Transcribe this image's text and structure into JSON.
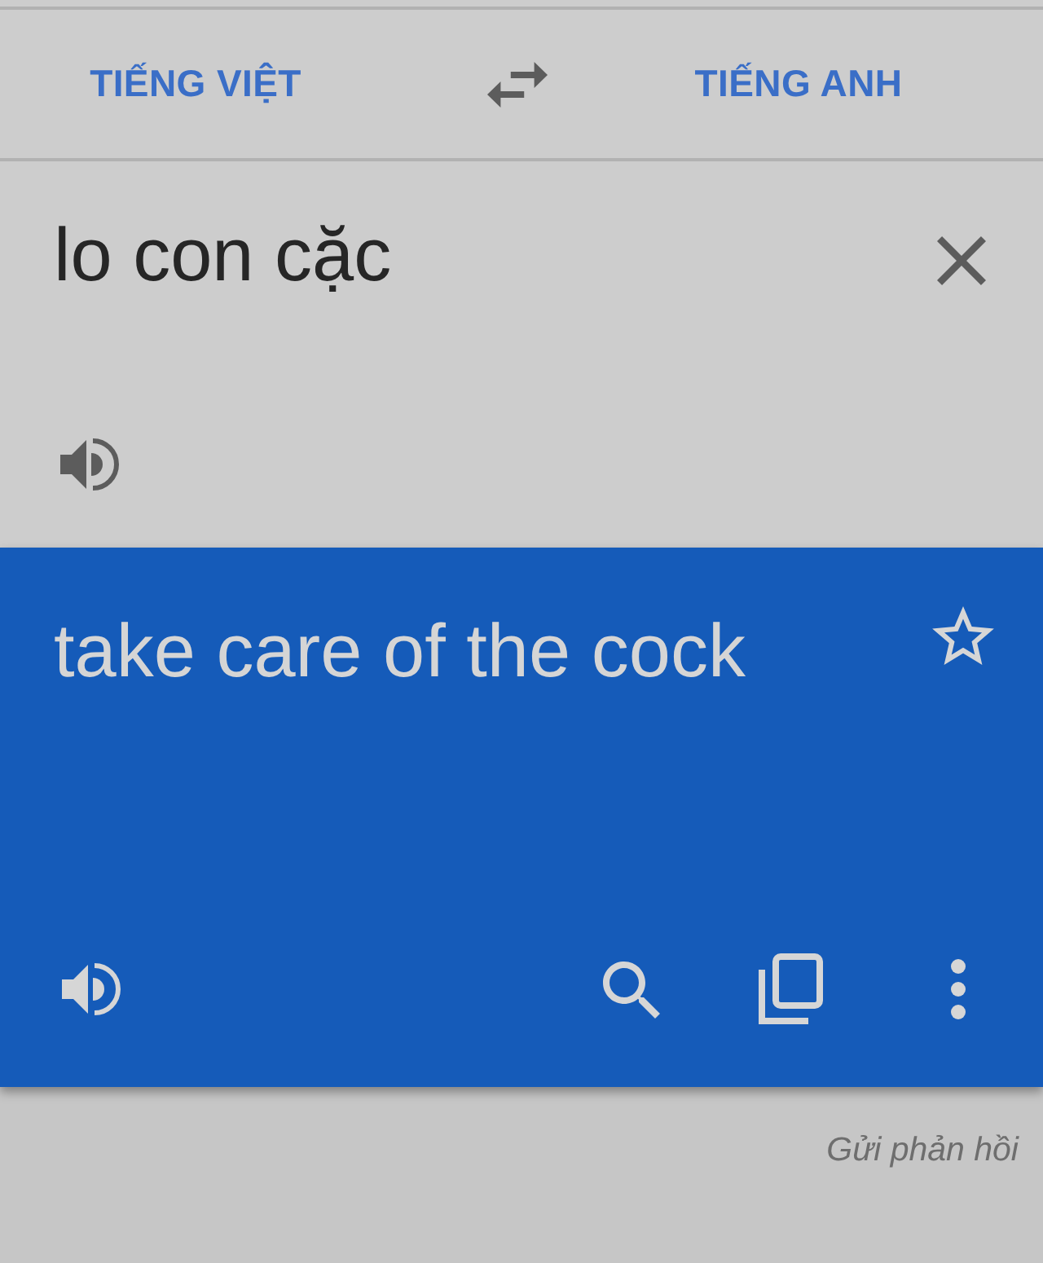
{
  "languages": {
    "source": "TIẾNG VIỆT",
    "target": "TIẾNG ANH"
  },
  "source": {
    "text": "lo con cặc"
  },
  "result": {
    "text": "take care of the cock",
    "starred": false
  },
  "feedback_link": "Gửi phản hồi"
}
